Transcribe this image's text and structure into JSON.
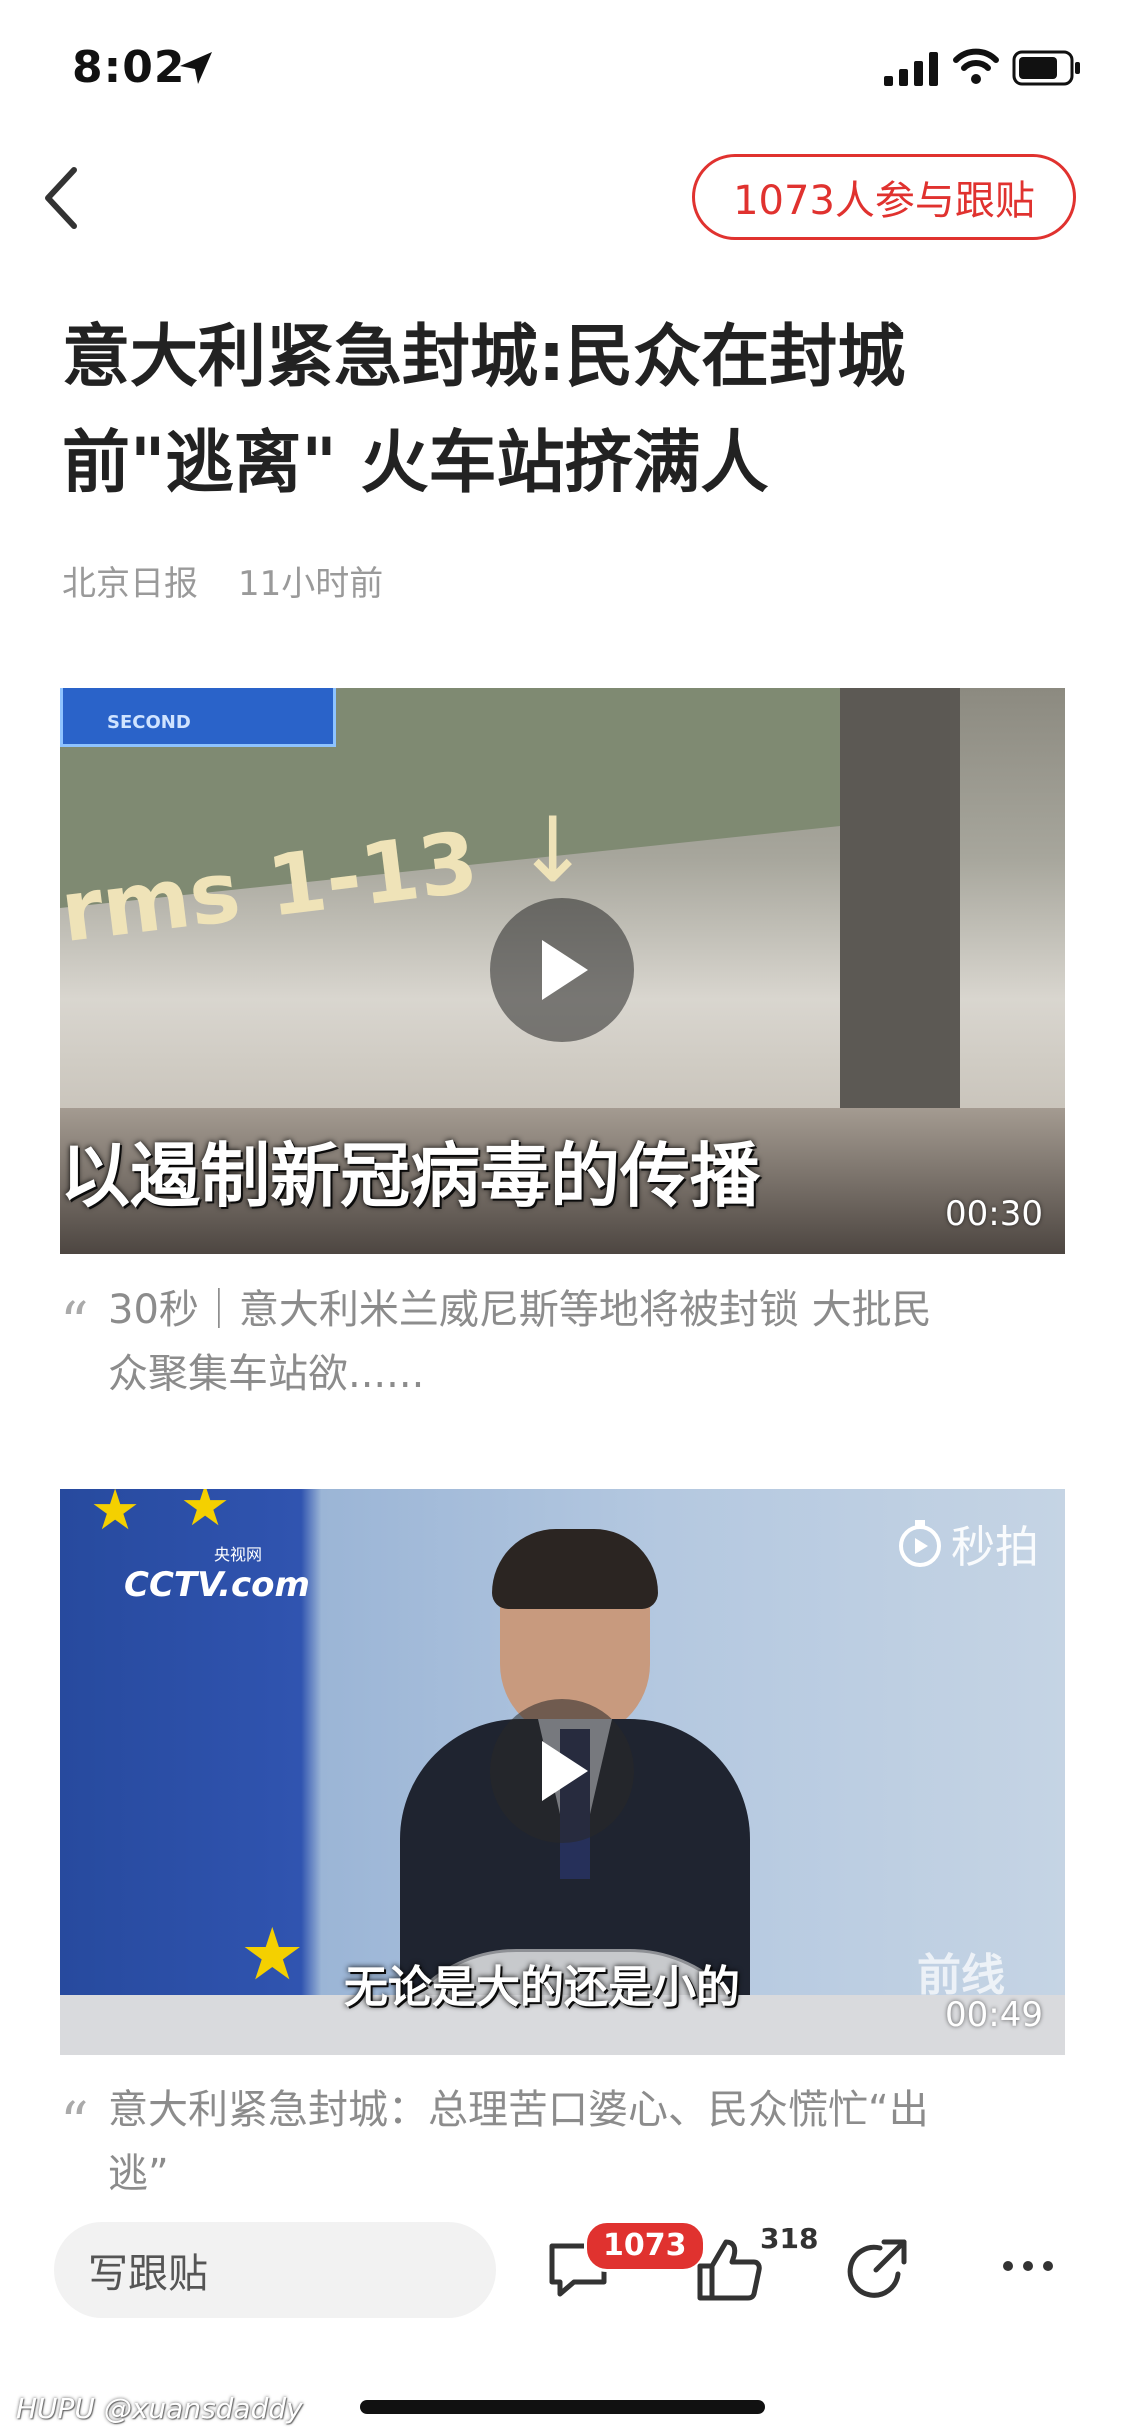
{
  "status_bar": {
    "time": "8:02"
  },
  "nav": {
    "follow_label": "1073人参与跟贴"
  },
  "article": {
    "title_line1": "意大利紧急封城:民众在封城",
    "title_line2": "前\"逃离\" 火车站挤满人",
    "source": "北京日报",
    "time_ago": "11小时前"
  },
  "videos": [
    {
      "duration": "00:30",
      "overlay_text_top": "rms 1-13",
      "overlay_badge": "SECOND",
      "subtitle": "以遏制新冠病毒的传播",
      "caption_line1": "30秒｜意大利米兰威尼斯等地将被封锁 大批民",
      "caption_line2": "众聚集车站欲......"
    },
    {
      "duration": "00:49",
      "channel_logo": "CCTV.com",
      "channel_sub": "央视网",
      "brand_mark": "秒拍",
      "corner_mark": "前线",
      "subtitle": "无论是大的还是小的",
      "caption_line1": "意大利紧急封城：总理苦口婆心、民众慌忙“出",
      "caption_line2": "逃”"
    }
  ],
  "bottom_bar": {
    "compose_placeholder": "写跟贴",
    "comment_count": "1073",
    "like_count": "318"
  },
  "watermark": {
    "site": "HUPU",
    "user": "@xuansdaddy"
  },
  "colors": {
    "accent": "#e0322f",
    "meta_gray": "#9a9a9a"
  }
}
